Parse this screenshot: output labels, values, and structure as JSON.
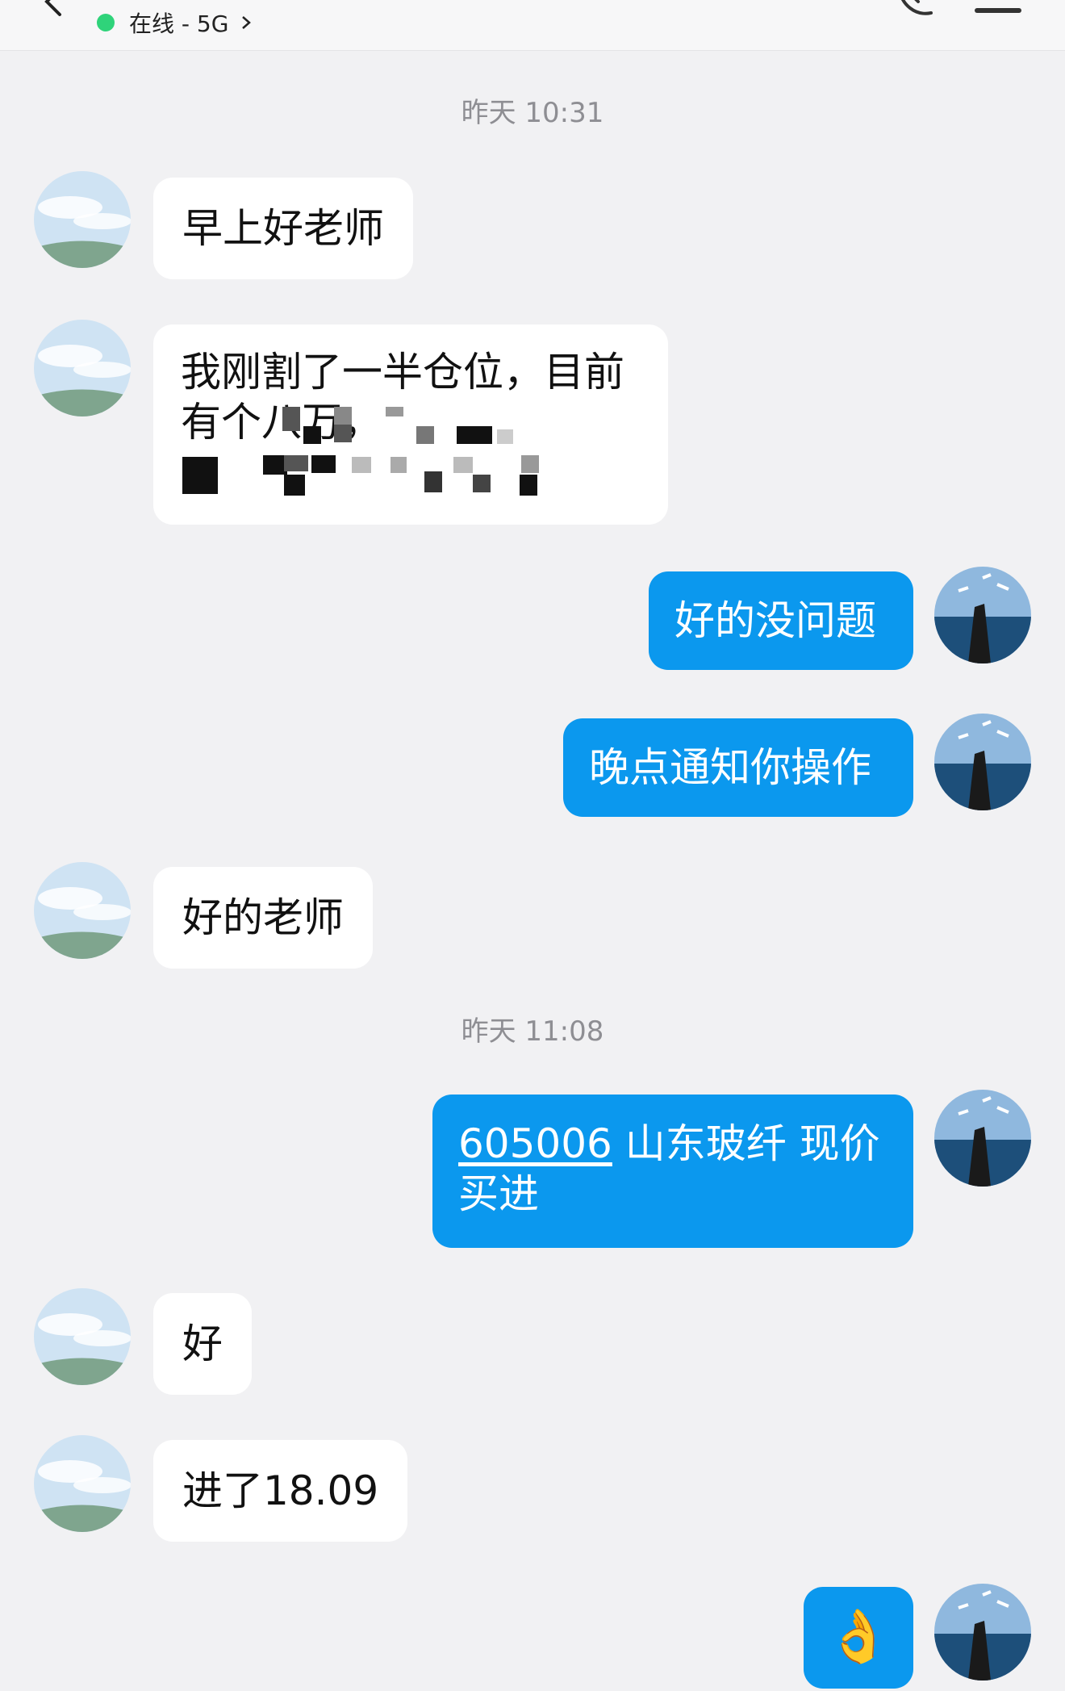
{
  "header": {
    "status_text": "在线 - 5G",
    "online_color": "#2fd37a",
    "back_icon": "back-arrow-icon",
    "phone_icon": "phone-icon",
    "menu_icon": "menu-icon"
  },
  "timestamps": {
    "t1": "昨天 10:31",
    "t2": "昨天 11:08"
  },
  "messages": {
    "m1": "早上好老师",
    "m2_line1": "我刚割了一半仓位，目前",
    "m2_line2": "有个八万，",
    "m3": "好的没问题",
    "m4": "晚点通知你操作",
    "m5": "好的老师",
    "m6_code": "605006",
    "m6_line1_rest": " 山东玻纤 现价",
    "m6_line2": "买进",
    "m7": "好",
    "m8": "进了18.09",
    "m9": "👌"
  },
  "colors": {
    "incoming_bubble": "#ffffff",
    "outgoing_bubble": "#0b98ee",
    "background": "#f1f1f3"
  }
}
